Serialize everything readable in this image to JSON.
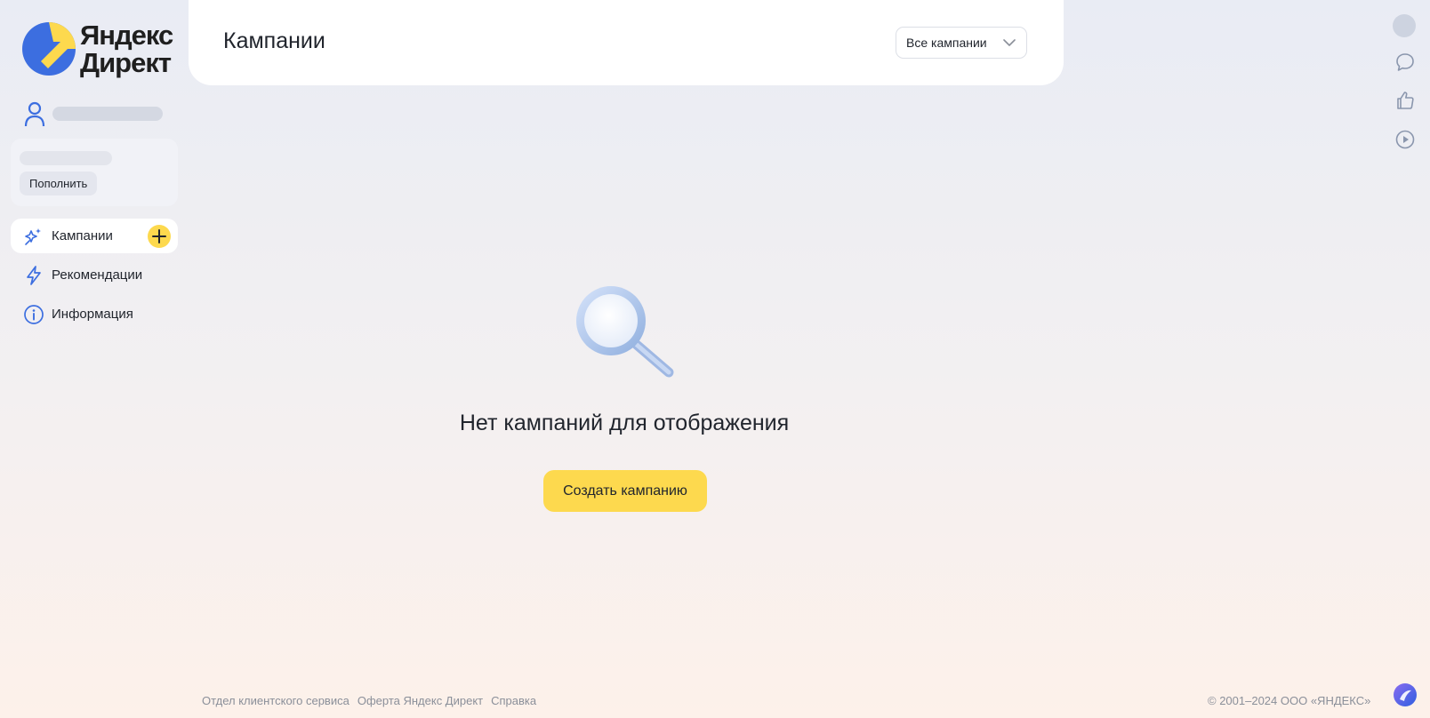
{
  "brand": {
    "line1": "Яндекс",
    "line2": "Директ",
    "colors": {
      "yellow": "#fdd94e",
      "blue": "#3c6ee0"
    }
  },
  "sidebar": {
    "balance": {
      "topup_label": "Пополнить"
    },
    "items": [
      {
        "label": "Кампании",
        "icon": "campaigns-sparkle-icon",
        "active": true,
        "add_icon": "plus-icon"
      },
      {
        "label": "Рекомендации",
        "icon": "lightning-icon",
        "active": false
      },
      {
        "label": "Информация",
        "icon": "info-icon",
        "active": false
      }
    ]
  },
  "header": {
    "title": "Кампании",
    "filter": {
      "selected": "Все кампании",
      "icon": "chevron-down-icon"
    }
  },
  "empty_state": {
    "icon": "magnifier-icon",
    "message": "Нет кампаний для отображения",
    "button_label": "Создать кампанию"
  },
  "right_rail": {
    "items": [
      "avatar",
      "chat-icon",
      "thumbs-up-icon",
      "play-icon"
    ]
  },
  "footer": {
    "links": [
      "Отдел клиентского сервиса",
      "Оферта Яндекс Директ",
      "Справка"
    ],
    "copyright": "© 2001–2024 ООО «ЯНДЕКС»",
    "assistant_icon": "alice-icon"
  }
}
